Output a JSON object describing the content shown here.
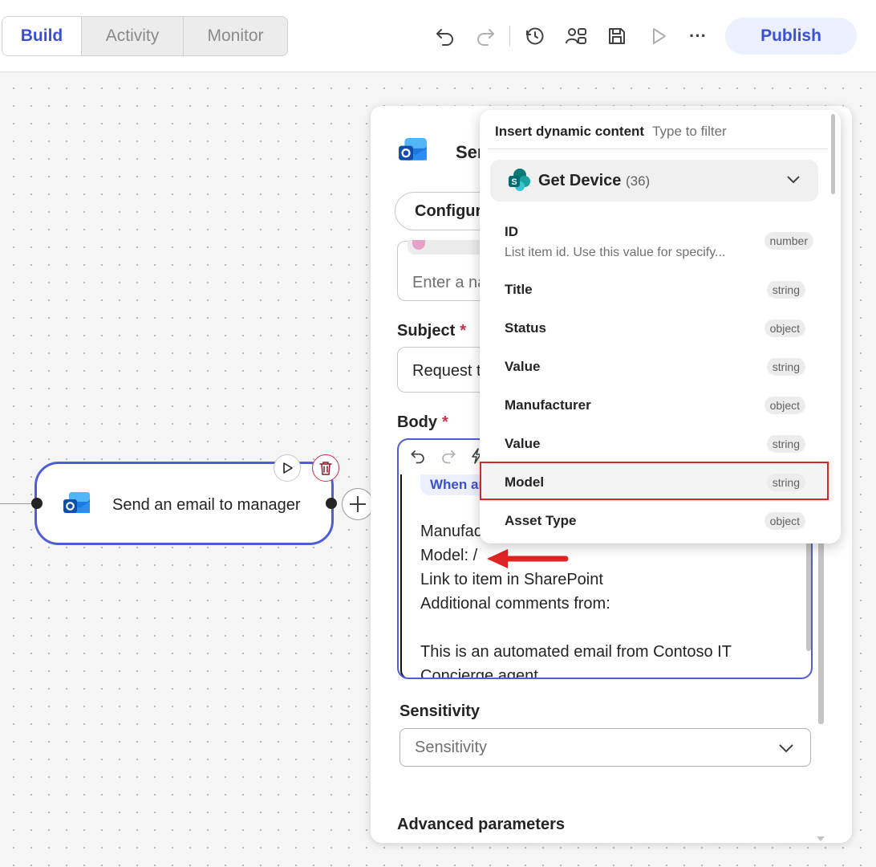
{
  "tabs": {
    "build": "Build",
    "activity": "Activity",
    "monitor": "Monitor"
  },
  "toolbar": {
    "undo_icon": "undo-icon",
    "redo_icon": "redo-icon",
    "history_icon": "history-icon",
    "flow_checker_icon": "flow-checker-icon",
    "save_icon": "save-icon",
    "test_icon": "play-icon",
    "more_label": "···",
    "publish_label": "Publish"
  },
  "node": {
    "title": "Send an email to manager",
    "icon": "outlook-icon"
  },
  "panel": {
    "title": "Ser",
    "config_tab": "Configur",
    "to_placeholder": "Enter a na",
    "subject_label": "Subject",
    "subject_value": "Request t",
    "body_label": "Body",
    "required_mark": "*",
    "body_chip": "When ar",
    "body_lines": [
      "Manufac",
      "Model: /",
      "Link to item in SharePoint",
      "Additional comments from:",
      "",
      "This is an automated email from Contoso IT",
      "Concierge agent"
    ],
    "sensitivity_label": "Sensitivity",
    "sensitivity_placeholder": "Sensitivity",
    "advanced_label": "Advanced parameters"
  },
  "dynamic_content": {
    "title": "Insert dynamic content",
    "filter_placeholder": "Type to filter",
    "group": {
      "name": "Get Device",
      "count": "(36)",
      "icon": "sharepoint-icon"
    },
    "items": [
      {
        "name": "ID",
        "desc": "List item id. Use this value for specify...",
        "type": "number"
      },
      {
        "name": "Title",
        "type": "string"
      },
      {
        "name": "Status",
        "type": "object"
      },
      {
        "name": "Value",
        "type": "string"
      },
      {
        "name": "Manufacturer",
        "type": "object"
      },
      {
        "name": "Value",
        "type": "string"
      },
      {
        "name": "Model",
        "type": "string"
      },
      {
        "name": "Asset Type",
        "type": "object"
      }
    ],
    "highlighted_item": "Model"
  },
  "colors": {
    "accent": "#3b4fd6",
    "highlight": "#d42828",
    "arrow": "#e02424"
  }
}
